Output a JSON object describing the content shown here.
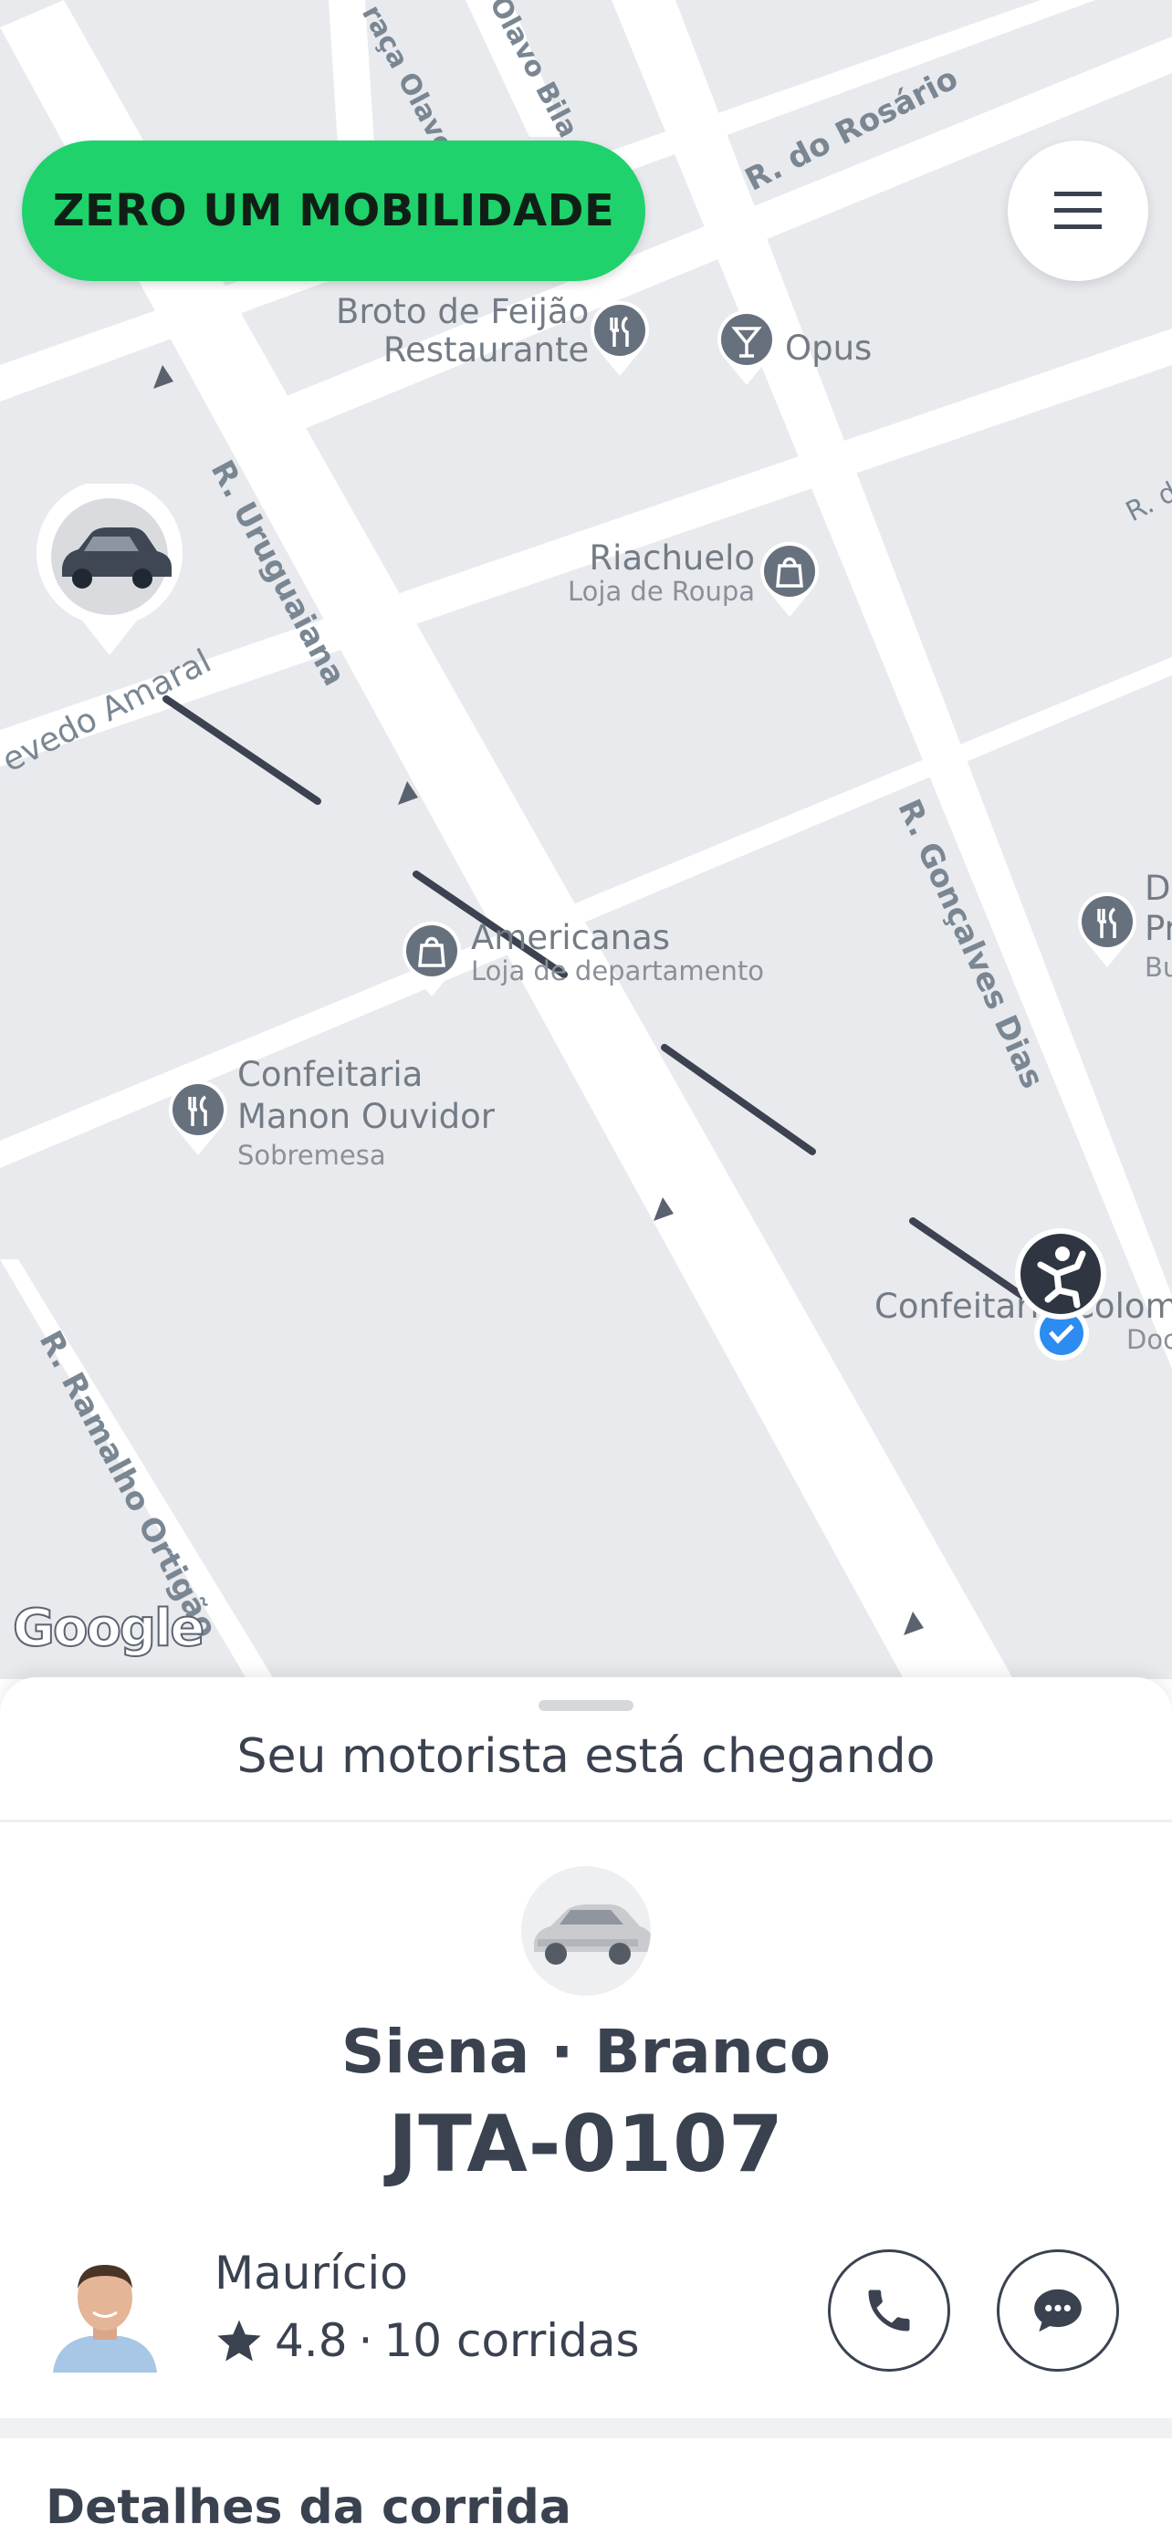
{
  "brand": {
    "name": "ZERO UM MOBILIDADE",
    "color": "#1fd26b"
  },
  "menu": {
    "icon": "hamburger-menu-icon"
  },
  "map": {
    "streets": [
      "R. do Rosário",
      "R. Uruguaiana",
      "evedo Amaral",
      "R. Gonçalves Dias",
      "R. Ramalho Ortigão",
      "raça Olavo",
      "Olavo Bila",
      "R. d"
    ],
    "pois": [
      {
        "title": "Broto de Feijão",
        "title2": "Restaurante",
        "icon": "restaurant-icon"
      },
      {
        "title": "Opus",
        "icon": "bar-icon"
      },
      {
        "title": "Riachuelo",
        "subtitle": "Loja de Roupa",
        "icon": "shopping-bag-icon"
      },
      {
        "title": "Americanas",
        "subtitle": "Loja de departamento",
        "icon": "shopping-bag-icon"
      },
      {
        "title": "Confeitaria",
        "title2": "Manon Ouvidor",
        "subtitle": "Sobremesa",
        "icon": "restaurant-icon"
      },
      {
        "title": "Confeitaria Colomb",
        "subtitle": "Doc",
        "icon": "destination-check-icon"
      },
      {
        "title": "D",
        "title2": "Pr",
        "subtitle": "Bu",
        "icon": "restaurant-icon"
      }
    ],
    "attribution": "Google"
  },
  "sheet": {
    "status": "Seu motorista está chegando",
    "vehicle": {
      "model": "Siena · Branco",
      "plate": "JTA-0107"
    },
    "driver": {
      "name": "Maurício",
      "rating": "4.8",
      "rides": "10 corridas",
      "separator": "·"
    },
    "details_title": "Detalhes da corrida"
  }
}
